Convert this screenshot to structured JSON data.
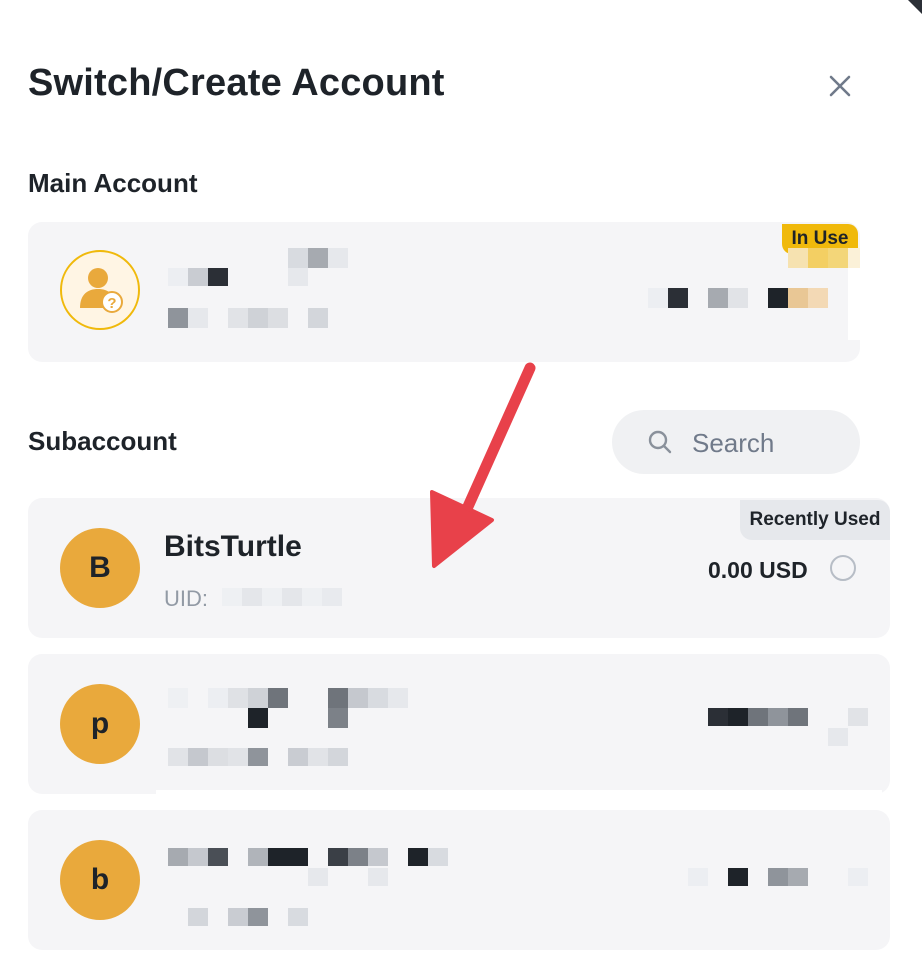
{
  "dialog": {
    "title": "Switch/Create Account",
    "close_icon": "close-icon"
  },
  "main_account": {
    "section_label": "Main Account",
    "badge": "In Use",
    "avatar_icon": "user-question-avatar-icon"
  },
  "subaccount": {
    "section_label": "Subaccount",
    "search": {
      "placeholder": "Search",
      "icon": "search-icon"
    },
    "items": [
      {
        "avatar_letter": "B",
        "name": "BitsTurtle",
        "uid_label": "UID:",
        "balance": "0.00 USD",
        "badge": "Recently Used"
      },
      {
        "avatar_letter": "p"
      },
      {
        "avatar_letter": "b"
      }
    ]
  },
  "colors": {
    "accent": "#f0b90b",
    "avatar_bg": "#e9a93c",
    "card_bg": "#f5f5f7",
    "annotation_arrow": "#e8414a"
  }
}
